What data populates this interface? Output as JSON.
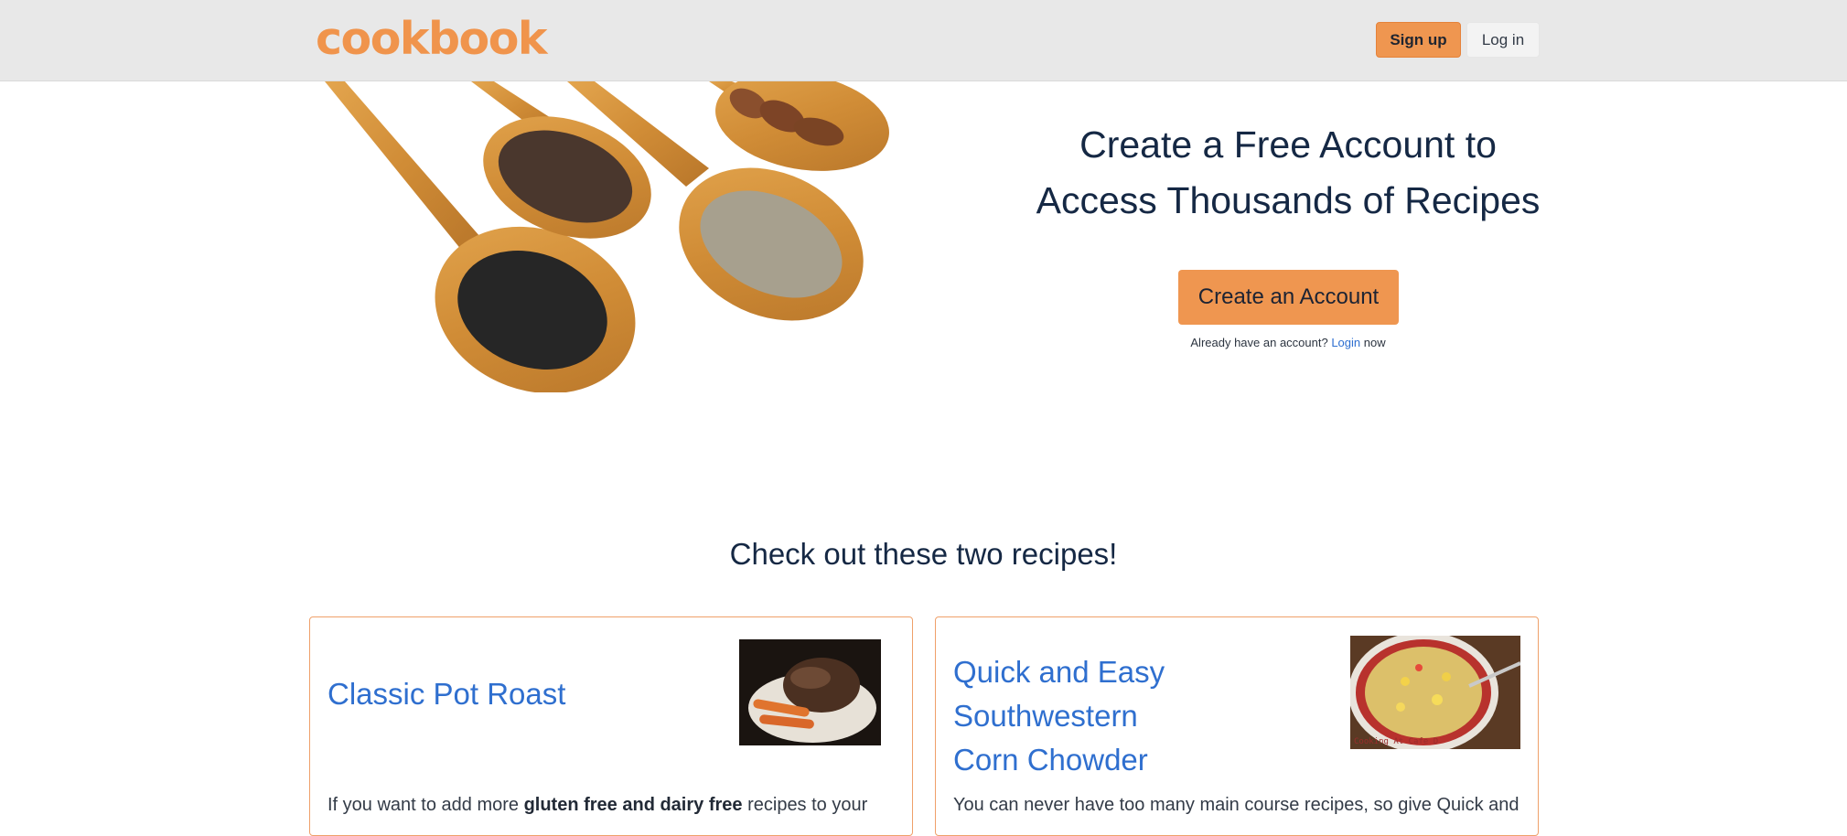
{
  "navbar": {
    "logo": "cookbook",
    "signup_label": "Sign up",
    "login_label": "Log in"
  },
  "hero": {
    "title_line1": "Create a Free Account to",
    "title_line2": "Access Thousands of Recipes",
    "cta_label": "Create an Account",
    "already_prefix": "Already have an account? ",
    "login_link": "Login",
    "already_suffix": " now"
  },
  "recipes": {
    "section_title": "Check out these two recipes!",
    "items": [
      {
        "title": "Classic Pot Roast",
        "desc_before": "If you want to add more ",
        "desc_bold": "gluten free and dairy free",
        "desc_after": " recipes to your"
      },
      {
        "title_line1": "Quick and Easy Southwestern",
        "title_line2": "Corn Chowder",
        "desc": "You can never have too many main course recipes, so give Quick and",
        "image_caption": "Cooking At Cafe D"
      }
    ]
  },
  "colors": {
    "accent": "#ef9650",
    "link": "#2f6fcf",
    "navbar_bg": "#e8e8e8",
    "heading": "#152844"
  }
}
